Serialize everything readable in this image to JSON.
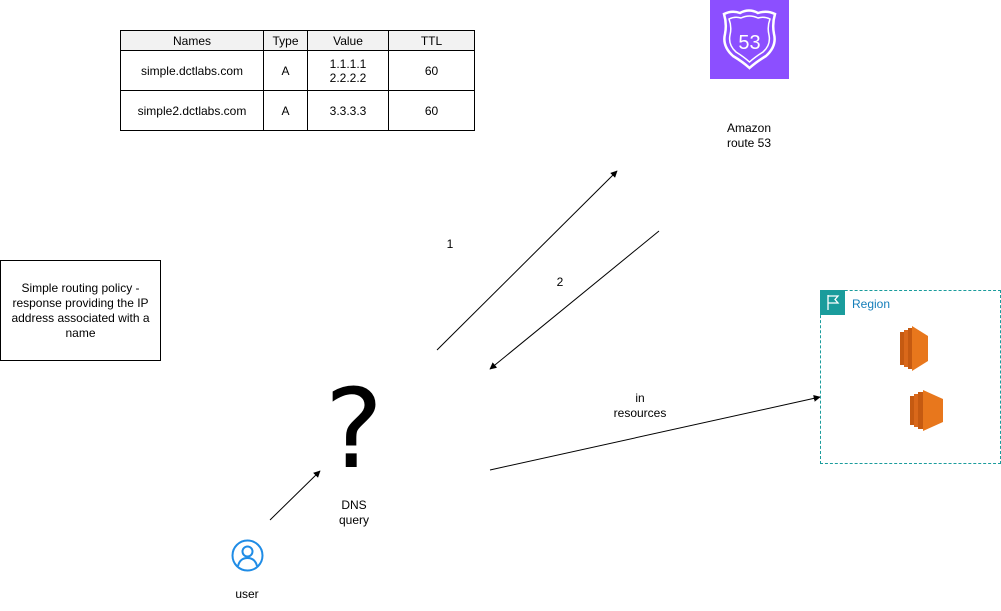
{
  "dns_table": {
    "headers": [
      "Names",
      "Type",
      "Value",
      "TTL"
    ],
    "rows": [
      {
        "name": "simple.dctlabs.com",
        "type": "A",
        "value_1": "1.1.1.1",
        "value_2": "2.2.2.2",
        "ttl": "60"
      },
      {
        "name": "simple2.dctlabs.com",
        "type": "A",
        "value_1": "3.3.3.3",
        "value_2": "",
        "ttl": "60"
      }
    ]
  },
  "route53": {
    "badge_number": "53",
    "label_line1": "Amazon",
    "label_line2": "route 53",
    "color": "#8c4fff"
  },
  "policy_note": "Simple routing policy - response providing the IP address associated with a name",
  "arrows": {
    "step1": "1",
    "step2": "2",
    "resources_line1": "in",
    "resources_line2": "resources"
  },
  "dns_query": {
    "symbol": "?",
    "line1": "DNS",
    "line2": "query"
  },
  "user": {
    "label": "user",
    "color": "#1f8ce6"
  },
  "region": {
    "title": "Region",
    "color": "#1a9c9c",
    "instance_color": "#e8771c"
  }
}
